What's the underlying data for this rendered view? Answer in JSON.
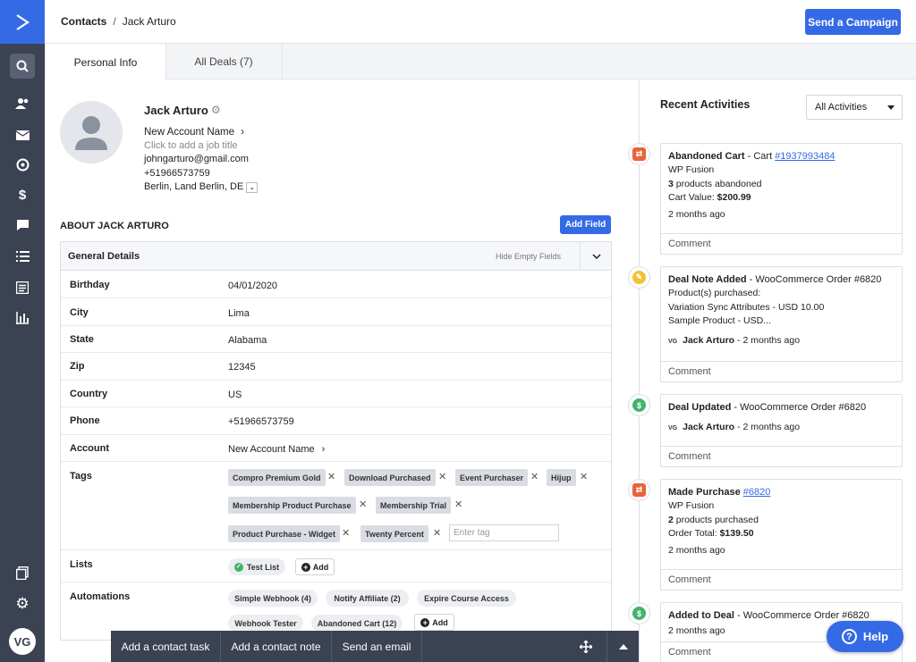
{
  "sidebar": {
    "avatar_initials": "VG",
    "icons": [
      "search-icon",
      "contacts-icon",
      "campaigns-icon",
      "automations-icon",
      "deals-icon",
      "conversations-icon",
      "lists-icon",
      "forms-icon",
      "reports-icon",
      "pages-icon",
      "settings-icon"
    ]
  },
  "header": {
    "breadcrumb_root": "Contacts",
    "breadcrumb_sep": "/",
    "breadcrumb_current": "Jack Arturo",
    "campaign_button": "Send a Campaign"
  },
  "tabs": [
    {
      "label": "Personal Info",
      "active": true
    },
    {
      "label": "All Deals (7)",
      "active": false
    }
  ],
  "profile": {
    "name": "Jack Arturo",
    "account": "New Account Name",
    "job_placeholder": "Click to add a job title",
    "email": "johngarturo@gmail.com",
    "phone": "+51966573759",
    "location": "Berlin, Land Berlin, DE"
  },
  "about": {
    "title": "ABOUT JACK ARTURO",
    "add_field": "Add Field",
    "section_title": "General Details",
    "hide_empty": "Hide Empty Fields",
    "fields": [
      {
        "key": "Birthday",
        "value": "04/01/2020"
      },
      {
        "key": "City",
        "value": "Lima"
      },
      {
        "key": "State",
        "value": "Alabama"
      },
      {
        "key": "Zip",
        "value": "12345"
      },
      {
        "key": "Country",
        "value": "US"
      },
      {
        "key": "Phone",
        "value": "+51966573759"
      },
      {
        "key": "Account",
        "value": "New Account Name"
      }
    ],
    "tags_label": "Tags",
    "tags": [
      "Compro Premium Gold",
      "Download Purchased",
      "Event Purchaser",
      "Hijup",
      "Membership Product Purchase",
      "Membership Trial",
      "Product Purchase - Widget",
      "Twenty Percent"
    ],
    "tag_placeholder": "Enter tag",
    "lists_label": "Lists",
    "lists": [
      "Test List"
    ],
    "add_label": "Add",
    "automations_label": "Automations",
    "automations": [
      "Simple Webhook (4)",
      "Notify Affiliate (2)",
      "Expire Course Access",
      "Webhook Tester",
      "Abandoned Cart (12)"
    ]
  },
  "bottom_bar": {
    "task": "Add a contact task",
    "note": "Add a contact note",
    "email": "Send an email"
  },
  "activities": {
    "title": "Recent Activities",
    "filter": "All Activities",
    "comment_label": "Comment",
    "items": [
      {
        "title": "Abandoned Cart",
        "sep": " - Cart ",
        "link": "#1937993484",
        "l1": "WP Fusion",
        "l2_bold": "3",
        "l2": " products abandoned",
        "l3": "Cart Value: ",
        "l3_bold": "$200.99",
        "time": "2 months ago",
        "color": "#e8643a"
      },
      {
        "title": "Deal Note Added",
        "sep": " - WooCommerce Order #6820",
        "l1": "Product(s) purchased:",
        "l2": "Variation Sync Attributes - USD 10.00",
        "l3": "Sample Product - USD...",
        "user": "Jack Arturo",
        "time": "2 months ago",
        "color": "#f2c230"
      },
      {
        "title": "Deal Updated",
        "sep": " - WooCommerce Order #6820",
        "user": "Jack Arturo",
        "time": "2 months ago",
        "color": "#43b36b"
      },
      {
        "title": "Made Purchase",
        "sep": " ",
        "link": "#6820",
        "l1": "WP Fusion",
        "l2_bold": "2",
        "l2": " products purchased",
        "l3": "Order Total: ",
        "l3_bold": "$139.50",
        "time": "2 months ago",
        "color": "#e8643a"
      },
      {
        "title": "Added to Deal",
        "sep": " - WooCommerce Order #6820",
        "time": "2 months ago",
        "color": "#43b36b"
      }
    ],
    "user_initials": "VG"
  },
  "help": {
    "label": "Help"
  }
}
